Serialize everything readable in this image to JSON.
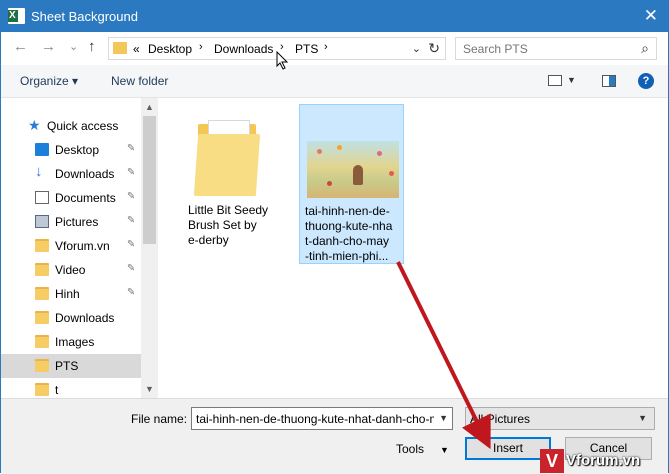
{
  "window": {
    "title": "Sheet Background",
    "app_icon_letter": "X",
    "close_glyph": "✕"
  },
  "nav_buttons": {
    "back": "←",
    "forward": "→",
    "recent": "⌄",
    "up": "↑"
  },
  "address": {
    "overflow": "«",
    "crumbs": [
      "Desktop",
      "Downloads",
      "PTS"
    ],
    "separator": "›",
    "dropdown_glyph": "⌄",
    "refresh_glyph": "↻"
  },
  "search": {
    "placeholder": "Search PTS",
    "icon": "search-icon"
  },
  "toolbar": {
    "organize": "Organize ▾",
    "new_folder": "New folder",
    "help": "?"
  },
  "nav_pane": {
    "quick_access": "Quick access",
    "items": [
      {
        "label": "Desktop",
        "icon": "desktop-icon",
        "pinned": true
      },
      {
        "label": "Downloads",
        "icon": "downloads-icon",
        "pinned": true
      },
      {
        "label": "Documents",
        "icon": "documents-icon",
        "pinned": true
      },
      {
        "label": "Pictures",
        "icon": "pictures-icon",
        "pinned": true
      },
      {
        "label": "Vforum.vn",
        "icon": "folder-icon",
        "pinned": true
      },
      {
        "label": "Video",
        "icon": "folder-icon",
        "pinned": true
      },
      {
        "label": "Hinh",
        "icon": "folder-icon",
        "pinned": true
      },
      {
        "label": "Downloads",
        "icon": "folder-icon",
        "pinned": false
      },
      {
        "label": "Images",
        "icon": "folder-icon",
        "pinned": false
      },
      {
        "label": "PTS",
        "icon": "folder-icon",
        "pinned": false,
        "selected": true
      },
      {
        "label": "t",
        "icon": "folder-icon",
        "pinned": false
      }
    ],
    "pin_glyph": "📌"
  },
  "files": [
    {
      "name_lines": [
        "Little Bit Seedy",
        "Brush Set by",
        "e-derby"
      ],
      "type": "folder"
    },
    {
      "name_lines": [
        "tai-hinh-nen-de-",
        "thuong-kute-nha",
        "t-danh-cho-may",
        "-tinh-mien-phi..."
      ],
      "type": "image",
      "selected": true
    }
  ],
  "bottom": {
    "file_name_label": "File name:",
    "file_name_value": "tai-hinh-nen-de-thuong-kute-nhat-danh-cho-may-tinh-mien-phi",
    "file_type": "All Pictures",
    "tools": "Tools",
    "insert": "Insert",
    "cancel": "Cancel"
  },
  "watermark": {
    "letter": "V",
    "text": "Vforum.vn"
  },
  "colors": {
    "titlebar": "#2b79c1",
    "selection": "#cce8ff",
    "arrow": "#c0161d",
    "default_button_border": "#0078d7"
  }
}
